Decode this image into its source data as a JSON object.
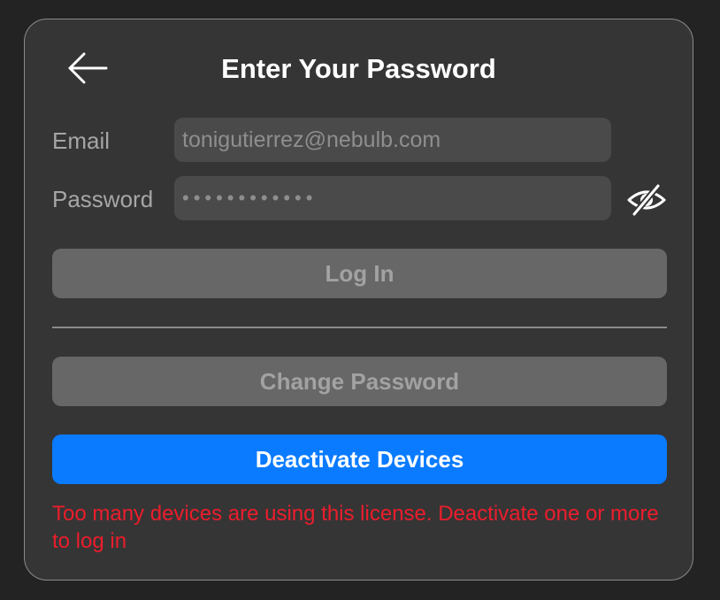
{
  "dialog": {
    "title": "Enter Your Password",
    "back_icon": "arrow-left-icon"
  },
  "form": {
    "email_label": "Email",
    "email_value": "tonigutierrez@nebulb.com",
    "password_label": "Password",
    "password_value": "••••••••••••",
    "visibility_icon": "eye-slash-icon"
  },
  "buttons": {
    "login_label": "Log In",
    "change_password_label": "Change Password",
    "deactivate_label": "Deactivate Devices"
  },
  "error_message": "Too many devices are using this license. Deactivate one or more to log in",
  "colors": {
    "background": "#232323",
    "panel": "#353535",
    "accent": "#0a7bff",
    "error": "#ec1d2c",
    "disabled_button": "#676767"
  }
}
